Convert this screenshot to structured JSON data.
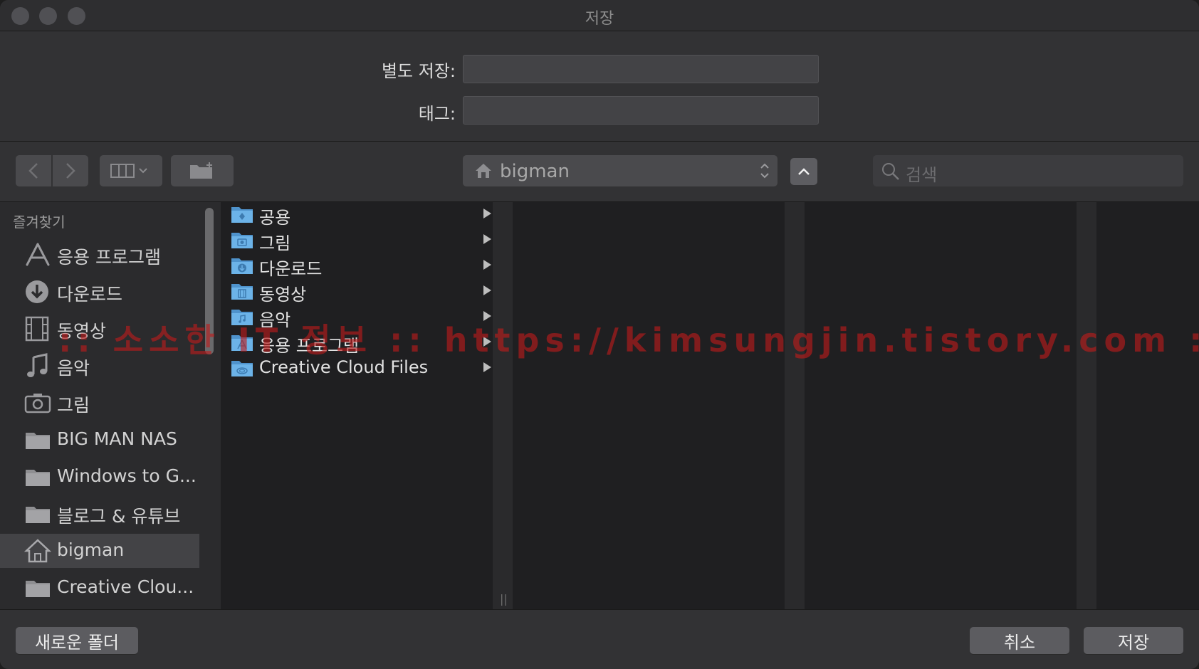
{
  "window": {
    "title": "저장"
  },
  "form": {
    "save_as_label": "별도 저장:",
    "save_as_value": "",
    "tags_label": "태그:",
    "tags_value": ""
  },
  "toolbar": {
    "back_icon": "chevron-left-icon",
    "forward_icon": "chevron-right-icon",
    "view_icon": "column-view-icon",
    "new_folder_icon": "new-folder-icon",
    "path_location": "bigman",
    "search_placeholder": "검색"
  },
  "sidebar": {
    "header": "즐겨찾기",
    "items": [
      {
        "label": "응용 프로그램",
        "icon": "applications-icon",
        "selected": false
      },
      {
        "label": "다운로드",
        "icon": "download-icon",
        "selected": false
      },
      {
        "label": "동영상",
        "icon": "film-icon",
        "selected": false
      },
      {
        "label": "음악",
        "icon": "music-note-icon",
        "selected": false
      },
      {
        "label": "그림",
        "icon": "camera-icon",
        "selected": false
      },
      {
        "label": "BIG MAN NAS",
        "icon": "folder-icon",
        "selected": false
      },
      {
        "label": "Windows to G...",
        "icon": "folder-icon",
        "selected": false
      },
      {
        "label": "블로그 & 유튜브",
        "icon": "folder-icon",
        "selected": false
      },
      {
        "label": "bigman",
        "icon": "home-icon",
        "selected": true
      },
      {
        "label": "Creative Clou...",
        "icon": "folder-icon",
        "selected": false
      }
    ]
  },
  "browser": {
    "files": [
      {
        "label": "공용",
        "icon": "public-folder-icon"
      },
      {
        "label": "그림",
        "icon": "pictures-folder-icon"
      },
      {
        "label": "다운로드",
        "icon": "downloads-folder-icon"
      },
      {
        "label": "동영상",
        "icon": "movies-folder-icon"
      },
      {
        "label": "음악",
        "icon": "music-folder-icon"
      },
      {
        "label": "응용 프로그램",
        "icon": "applications-folder-icon"
      },
      {
        "label": "Creative Cloud Files",
        "icon": "creative-cloud-folder-icon"
      }
    ]
  },
  "buttons": {
    "new_folder": "새로운 폴더",
    "cancel": "취소",
    "save": "저장"
  },
  "watermark": ":: 소소한 IT 정보 :: https://kimsungjin.tistory.com ::",
  "colors": {
    "window_bg": "#323234",
    "sidebar_bg": "#2b2b2d",
    "column_bg": "#1f1f21",
    "folder_blue": "#5fa8e0",
    "watermark_red": "#be1c1c"
  }
}
